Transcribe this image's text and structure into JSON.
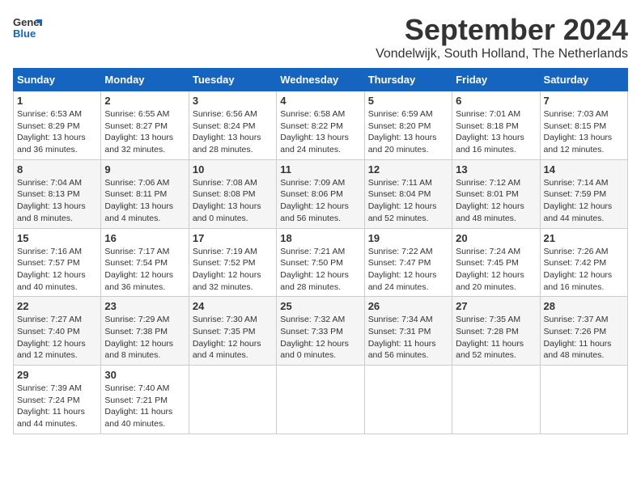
{
  "header": {
    "logo_general": "General",
    "logo_blue": "Blue",
    "month_title": "September 2024",
    "subtitle": "Vondelwijk, South Holland, The Netherlands"
  },
  "calendar": {
    "days_of_week": [
      "Sunday",
      "Monday",
      "Tuesday",
      "Wednesday",
      "Thursday",
      "Friday",
      "Saturday"
    ],
    "weeks": [
      [
        {
          "day": "1",
          "sunrise": "6:53 AM",
          "sunset": "8:29 PM",
          "daylight": "13 hours and 36 minutes."
        },
        {
          "day": "2",
          "sunrise": "6:55 AM",
          "sunset": "8:27 PM",
          "daylight": "13 hours and 32 minutes."
        },
        {
          "day": "3",
          "sunrise": "6:56 AM",
          "sunset": "8:24 PM",
          "daylight": "13 hours and 28 minutes."
        },
        {
          "day": "4",
          "sunrise": "6:58 AM",
          "sunset": "8:22 PM",
          "daylight": "13 hours and 24 minutes."
        },
        {
          "day": "5",
          "sunrise": "6:59 AM",
          "sunset": "8:20 PM",
          "daylight": "13 hours and 20 minutes."
        },
        {
          "day": "6",
          "sunrise": "7:01 AM",
          "sunset": "8:18 PM",
          "daylight": "13 hours and 16 minutes."
        },
        {
          "day": "7",
          "sunrise": "7:03 AM",
          "sunset": "8:15 PM",
          "daylight": "13 hours and 12 minutes."
        }
      ],
      [
        {
          "day": "8",
          "sunrise": "7:04 AM",
          "sunset": "8:13 PM",
          "daylight": "13 hours and 8 minutes."
        },
        {
          "day": "9",
          "sunrise": "7:06 AM",
          "sunset": "8:11 PM",
          "daylight": "13 hours and 4 minutes."
        },
        {
          "day": "10",
          "sunrise": "7:08 AM",
          "sunset": "8:08 PM",
          "daylight": "13 hours and 0 minutes."
        },
        {
          "day": "11",
          "sunrise": "7:09 AM",
          "sunset": "8:06 PM",
          "daylight": "12 hours and 56 minutes."
        },
        {
          "day": "12",
          "sunrise": "7:11 AM",
          "sunset": "8:04 PM",
          "daylight": "12 hours and 52 minutes."
        },
        {
          "day": "13",
          "sunrise": "7:12 AM",
          "sunset": "8:01 PM",
          "daylight": "12 hours and 48 minutes."
        },
        {
          "day": "14",
          "sunrise": "7:14 AM",
          "sunset": "7:59 PM",
          "daylight": "12 hours and 44 minutes."
        }
      ],
      [
        {
          "day": "15",
          "sunrise": "7:16 AM",
          "sunset": "7:57 PM",
          "daylight": "12 hours and 40 minutes."
        },
        {
          "day": "16",
          "sunrise": "7:17 AM",
          "sunset": "7:54 PM",
          "daylight": "12 hours and 36 minutes."
        },
        {
          "day": "17",
          "sunrise": "7:19 AM",
          "sunset": "7:52 PM",
          "daylight": "12 hours and 32 minutes."
        },
        {
          "day": "18",
          "sunrise": "7:21 AM",
          "sunset": "7:50 PM",
          "daylight": "12 hours and 28 minutes."
        },
        {
          "day": "19",
          "sunrise": "7:22 AM",
          "sunset": "7:47 PM",
          "daylight": "12 hours and 24 minutes."
        },
        {
          "day": "20",
          "sunrise": "7:24 AM",
          "sunset": "7:45 PM",
          "daylight": "12 hours and 20 minutes."
        },
        {
          "day": "21",
          "sunrise": "7:26 AM",
          "sunset": "7:42 PM",
          "daylight": "12 hours and 16 minutes."
        }
      ],
      [
        {
          "day": "22",
          "sunrise": "7:27 AM",
          "sunset": "7:40 PM",
          "daylight": "12 hours and 12 minutes."
        },
        {
          "day": "23",
          "sunrise": "7:29 AM",
          "sunset": "7:38 PM",
          "daylight": "12 hours and 8 minutes."
        },
        {
          "day": "24",
          "sunrise": "7:30 AM",
          "sunset": "7:35 PM",
          "daylight": "12 hours and 4 minutes."
        },
        {
          "day": "25",
          "sunrise": "7:32 AM",
          "sunset": "7:33 PM",
          "daylight": "12 hours and 0 minutes."
        },
        {
          "day": "26",
          "sunrise": "7:34 AM",
          "sunset": "7:31 PM",
          "daylight": "11 hours and 56 minutes."
        },
        {
          "day": "27",
          "sunrise": "7:35 AM",
          "sunset": "7:28 PM",
          "daylight": "11 hours and 52 minutes."
        },
        {
          "day": "28",
          "sunrise": "7:37 AM",
          "sunset": "7:26 PM",
          "daylight": "11 hours and 48 minutes."
        }
      ],
      [
        {
          "day": "29",
          "sunrise": "7:39 AM",
          "sunset": "7:24 PM",
          "daylight": "11 hours and 44 minutes."
        },
        {
          "day": "30",
          "sunrise": "7:40 AM",
          "sunset": "7:21 PM",
          "daylight": "11 hours and 40 minutes."
        },
        null,
        null,
        null,
        null,
        null
      ]
    ]
  }
}
